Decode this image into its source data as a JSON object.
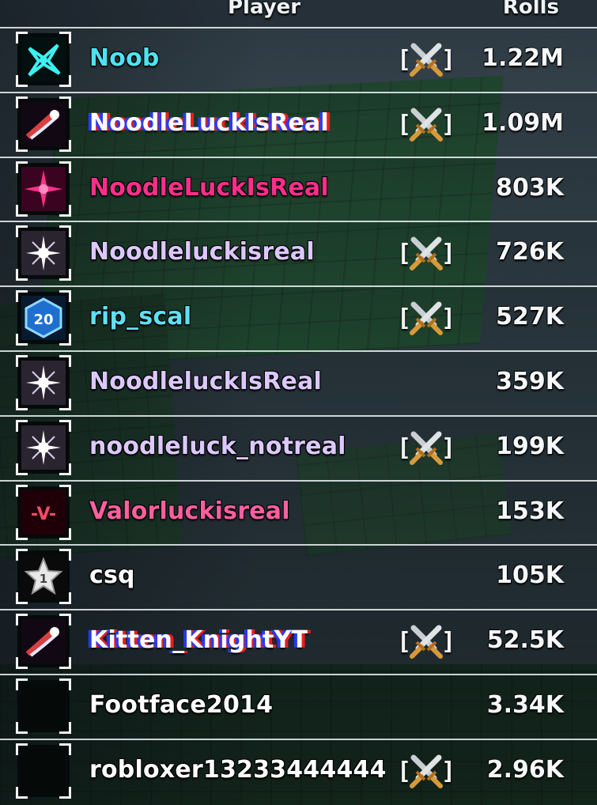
{
  "header": {
    "player": "Player",
    "rolls": "Rolls"
  },
  "rows": [
    {
      "name": "Noob",
      "rolls": "1.22M",
      "color": "#4de3f0",
      "pvp": true,
      "icon": "cyan-glyph-icon"
    },
    {
      "name": "NoodleLuckIsReal",
      "rolls": "1.09M",
      "color": "#ffffff",
      "pvp": true,
      "icon": "red-comet-icon"
    },
    {
      "name": "NoodleLuckIsReal",
      "rolls": "803K",
      "color": "#ff2e8a",
      "pvp": false,
      "icon": "pink-star-icon"
    },
    {
      "name": "Noodleluckisreal",
      "rolls": "726K",
      "color": "#dcc8ff",
      "pvp": true,
      "icon": "white-sparkle-icon"
    },
    {
      "name": "rip_scal",
      "rolls": "527K",
      "color": "#5fe0f2",
      "pvp": true,
      "icon": "d20-icon"
    },
    {
      "name": "NoodleluckIsReal",
      "rolls": "359K",
      "color": "#dcc8ff",
      "pvp": false,
      "icon": "white-sparkle-icon"
    },
    {
      "name": "noodleluck_notreal",
      "rolls": "199K",
      "color": "#dcc8ff",
      "pvp": true,
      "icon": "white-sparkle-icon"
    },
    {
      "name": "Valorluckisreal",
      "rolls": "153K",
      "color": "#ff5fa0",
      "pvp": false,
      "icon": "valor-badge-icon"
    },
    {
      "name": "csq",
      "rolls": "105K",
      "color": "#ffffff",
      "pvp": false,
      "icon": "star-badge-icon"
    },
    {
      "name": "Kitten_KnightYT",
      "rolls": "52.5K",
      "color": "#ffffff",
      "pvp": true,
      "icon": "red-comet-icon"
    },
    {
      "name": "Footface2014",
      "rolls": "3.34K",
      "color": "#ffffff",
      "pvp": false,
      "icon": "blank-avatar"
    },
    {
      "name": "robloxer13233444444",
      "rolls": "2.96K",
      "color": "#ffffff",
      "pvp": true,
      "icon": "blank-avatar"
    }
  ],
  "pvp_bracket_left": "[",
  "pvp_bracket_right": "]",
  "avatar_badge_d20": "20",
  "avatar_badge_valor": "-V-",
  "avatar_badge_star": "1"
}
